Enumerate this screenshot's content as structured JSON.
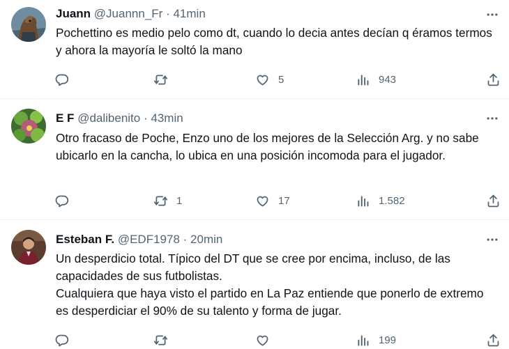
{
  "tweets": [
    {
      "author": {
        "name": "Juann",
        "handle": "@Juannn_Fr",
        "time": "41min"
      },
      "text": [
        "Pochettino es medio pelo como dt, cuando lo decia antes decían q éramos termos y ahora la mayoría le soltó la mano"
      ],
      "stats": {
        "replies": "",
        "retweets": "",
        "likes": "5",
        "views": "943"
      }
    },
    {
      "author": {
        "name": "E F",
        "handle": "@dalibenito",
        "time": "43min"
      },
      "text": [
        "Otro fracaso de Poche, Enzo uno de los mejores de la Selección Arg. y no sabe ubicarlo en la cancha, lo ubica en una posición incomoda para el jugador."
      ],
      "stats": {
        "replies": "",
        "retweets": "1",
        "likes": "17",
        "views": "1.582"
      }
    },
    {
      "author": {
        "name": "Esteban F.",
        "handle": "@EDF1978",
        "time": "20min"
      },
      "text": [
        "Un desperdicio total. Típico del DT que se cree por encima, incluso, de las capacidades de sus futbolistas.",
        "Cualquiera que haya visto el partido en La Paz entiende que ponerlo de extremo es desperdiciar el 90% de su talento y forma de jugar."
      ],
      "stats": {
        "replies": "",
        "retweets": "",
        "likes": "",
        "views": "199"
      }
    }
  ],
  "ui": {
    "separator": "·"
  },
  "icons": {
    "more": "more-horizontal-icon",
    "reply": "reply-bubble-icon",
    "retweet": "retweet-icon",
    "like": "heart-icon",
    "views": "views-bar-chart-icon",
    "share": "share-upload-icon"
  },
  "colors": {
    "text": "#0f1419",
    "secondary": "#536471",
    "divider": "#eff3f4"
  }
}
